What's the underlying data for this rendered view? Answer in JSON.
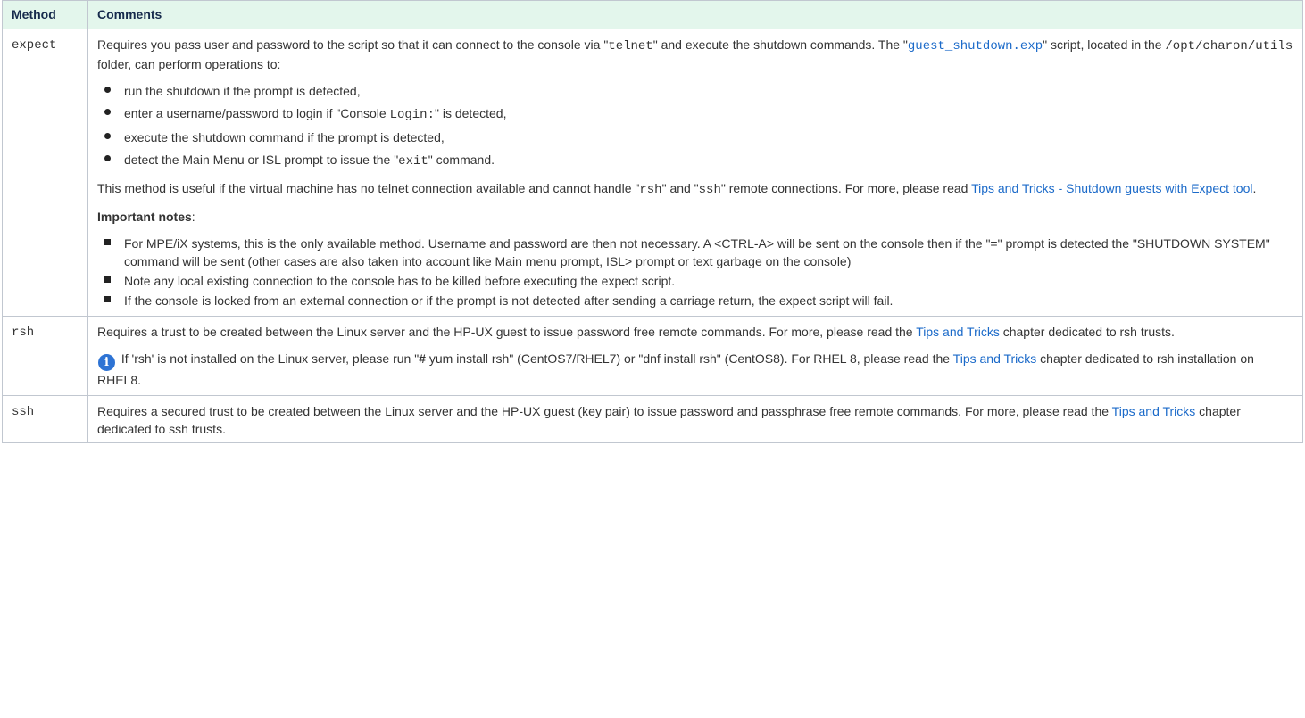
{
  "header": {
    "method": "Method",
    "comments": "Comments"
  },
  "rows": {
    "expect": {
      "method": "expect",
      "p1": {
        "a": "Requires you pass user and password to the script so that it can connect to the console via \"",
        "b": "telnet",
        "c": "\" and execute the shutdown commands. The \"",
        "d": "guest_shutdown.exp",
        "e": "\" script, located in the ",
        "f": "/opt/charon/utils",
        "g": " folder, can perform operations to:"
      },
      "list1": {
        "i0": "run the shutdown if the prompt is detected,",
        "i1a": "enter a username/password to login if \"Console ",
        "i1b": "Login:",
        "i1c": "\" is detected,",
        "i2": "execute the shutdown command if the prompt is detected,",
        "i3a": "detect the Main Menu or ISL prompt to issue the \"",
        "i3b": "exit",
        "i3c": "\" command."
      },
      "p2": {
        "a": "This method is useful if the virtual machine has no telnet connection available and cannot handle \"",
        "b": "rsh",
        "c": "\" and \"",
        "d": "ssh",
        "e": "\" remote connections. For more, please read ",
        "link": "Tips and Tricks - Shutdown guests with Expect tool",
        "f": "."
      },
      "notes_title": "Important notes",
      "notes_colon": ":",
      "notes": {
        "n0": "For MPE/iX systems, this is the only available method. Username and password are then not necessary. A <CTRL-A> will be sent on the console then if the \"=\" prompt is detected the \"SHUTDOWN SYSTEM\" command will be sent (other cases are also taken into account like Main menu prompt, ISL> prompt or text garbage on the console)",
        "n1": "Note any local existing connection to the console has to be killed before executing the expect script.",
        "n2": "If the console is locked from an external connection or if the prompt is not detected after sending a carriage return, the expect script will fail."
      }
    },
    "rsh": {
      "method": "rsh",
      "p1": {
        "a": "Requires a trust to be created between the Linux server and the HP-UX guest to issue password free remote commands. For more, please read the ",
        "link": "Tips and Tricks",
        "b": " chapter dedicated to rsh trusts."
      },
      "info_icon": "info-icon",
      "p2": {
        "a": " If 'rsh' is not installed on the Linux server, please run \"",
        "hash": "#",
        "b": " yum install rsh\" (CentOS7/RHEL7) or \"dnf install rsh\" (CentOS8). For RHEL 8, please read the ",
        "link": "Tips and Tricks",
        "c": " chapter dedicated to rsh installation on RHEL8."
      }
    },
    "ssh": {
      "method": "ssh",
      "p1": {
        "a": "Requires a secured trust to be created between the Linux server and the HP-UX guest (key pair) to issue password and passphrase free remote commands. For more, please read the ",
        "link": "Tips and Tricks",
        "b": " chapter dedicated to ssh trusts."
      }
    }
  },
  "colors": {
    "header_bg": "#e3f6ec",
    "header_text": "#172b4d",
    "link": "#1b6ac9",
    "border": "#c1c7d0",
    "info_icon": "#2d73d4"
  }
}
